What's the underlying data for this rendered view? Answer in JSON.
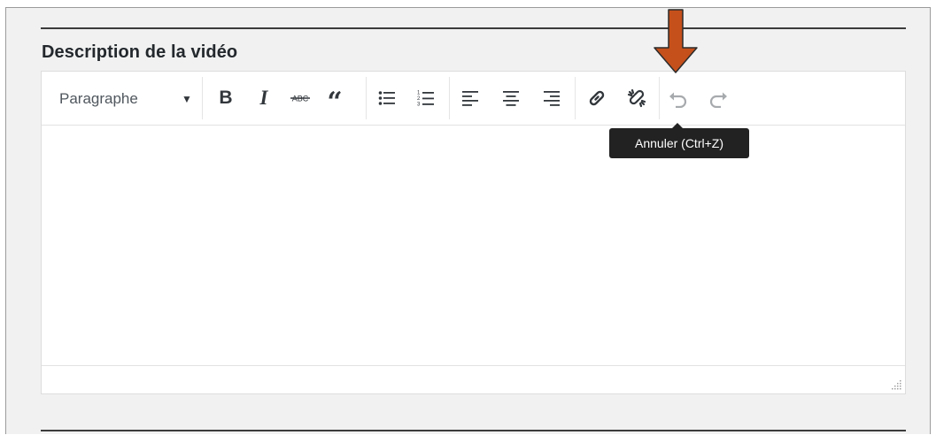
{
  "section": {
    "title": "Description de la vidéo"
  },
  "toolbar": {
    "format_value": "Paragraphe",
    "buttons": [
      {
        "name": "bold",
        "glyph": "B",
        "icon": "bold-icon"
      },
      {
        "name": "italic",
        "glyph": "I",
        "icon": "italic-icon"
      },
      {
        "name": "strikethrough",
        "glyph": "ABC",
        "icon": "strikethrough-icon"
      },
      {
        "name": "blockquote",
        "glyph": "66",
        "icon": "blockquote-icon"
      },
      {
        "name": "bullet-list",
        "icon": "bullet-list-icon"
      },
      {
        "name": "numbered-list",
        "icon": "numbered-list-icon"
      },
      {
        "name": "align-left",
        "icon": "align-left-icon"
      },
      {
        "name": "align-center",
        "icon": "align-center-icon"
      },
      {
        "name": "align-right",
        "icon": "align-right-icon"
      },
      {
        "name": "insert-link",
        "icon": "link-icon"
      },
      {
        "name": "remove-link",
        "icon": "unlink-icon"
      },
      {
        "name": "undo",
        "icon": "undo-icon"
      },
      {
        "name": "redo",
        "icon": "redo-icon"
      }
    ]
  },
  "tooltip": {
    "text": "Annuler (Ctrl+Z)"
  },
  "colors": {
    "annotation_arrow": "#c5501b",
    "annotation_arrow_border": "#2b2b2b",
    "tooltip_bg": "#222222",
    "icon": "#32373c",
    "icon_disabled": "#a7aaad"
  }
}
